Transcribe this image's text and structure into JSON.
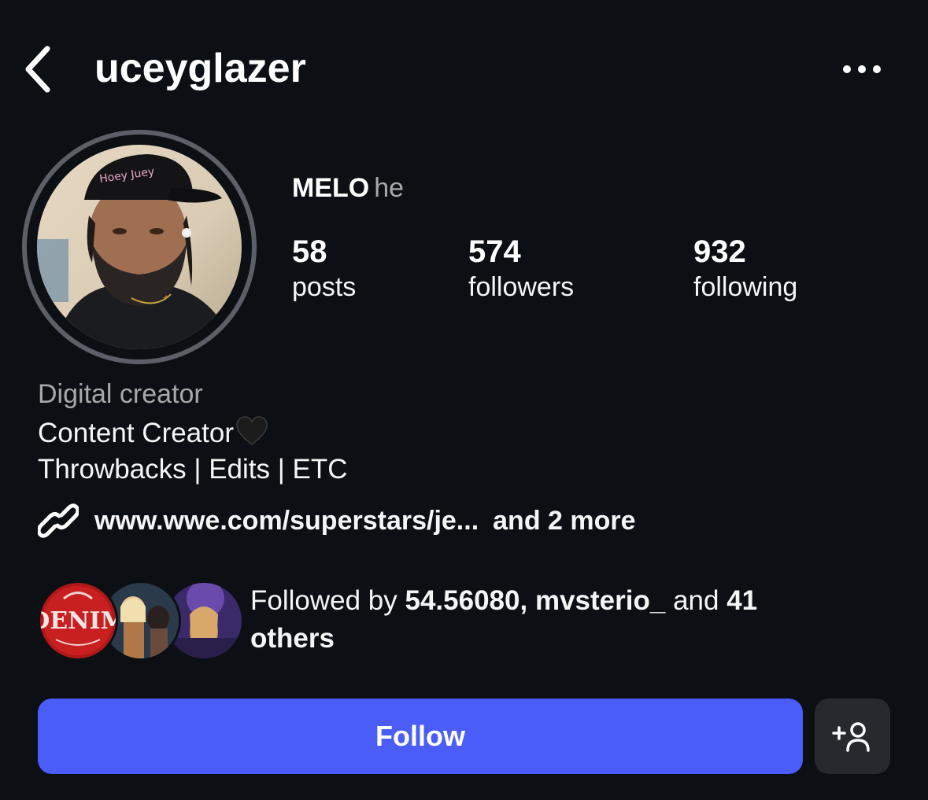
{
  "header": {
    "username": "uceyglazer",
    "back_icon": "chevron-left-icon",
    "more_icon": "more-horizontal-icon"
  },
  "profile": {
    "display_name": "MELO",
    "pronouns": "he",
    "stats": {
      "posts": {
        "value": "58",
        "label": "posts"
      },
      "followers": {
        "value": "574",
        "label": "followers"
      },
      "following": {
        "value": "932",
        "label": "following"
      }
    },
    "category": "Digital creator",
    "bio": {
      "line1": "Content Creator",
      "line1_emoji": "black-heart-icon",
      "line2": "Throwbacks | Edits | ETC"
    },
    "link": {
      "url_text": "www.wwe.com/superstars/je...",
      "more_text": "and 2 more",
      "icon": "link-icon"
    },
    "followed_by": {
      "prefix": "Followed by",
      "user1": "54.56080",
      "sep": ",",
      "user2": "mvsterio_",
      "and": "and",
      "count": "41",
      "others": "others"
    }
  },
  "actions": {
    "follow_label": "Follow",
    "suggest_icon": "add-person-icon"
  },
  "colors": {
    "background": "#0c1014",
    "follow_button": "#4a5df9",
    "secondary_button": "#262a2f",
    "muted_text": "#a8a8a8",
    "avatar_ring": "#5b6068"
  }
}
